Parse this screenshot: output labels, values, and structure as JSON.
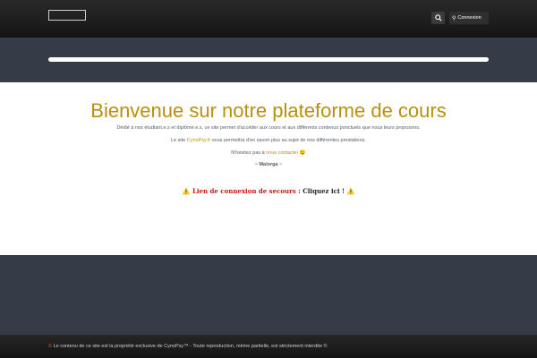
{
  "header": {
    "search_icon": "search-icon",
    "login_icon": "key-icon",
    "login_label": "Connexion"
  },
  "main": {
    "title": "Bienvenue sur notre plateforme de cours",
    "intro": "Dédié à nos étudiant.e.s et diplômé.e.s, ce site permet d'accéder aux cours et aux différents contenus ponctuels que nous leurs proposons.",
    "site_prefix": "Le site ",
    "site_link": "CynoPsy.fr",
    "site_suffix": " vous permettra d'en savoir plus au sujet de nos différentes prestations.",
    "contact_prefix": "N'hésitez pas à ",
    "contact_link": "nous contacter",
    "contact_emoji": "😉",
    "signature": "~ Malorga ~",
    "rescue_warn_left": "⚠️",
    "rescue_label": "Lien de connexion de secours",
    "rescue_sep": " : ",
    "rescue_link": "Cliquez ici !",
    "rescue_warn_right": "⚠️"
  },
  "footer": {
    "copyright_symbol": "©",
    "text": " Le contenu de ce site est la propriété exclusive de CynoPsy™ - Toute reproduction, même partielle, est strictement interdite ©"
  },
  "colors": {
    "accent": "#b8900f",
    "band": "#353c47",
    "rescue_red": "#c8170f"
  }
}
